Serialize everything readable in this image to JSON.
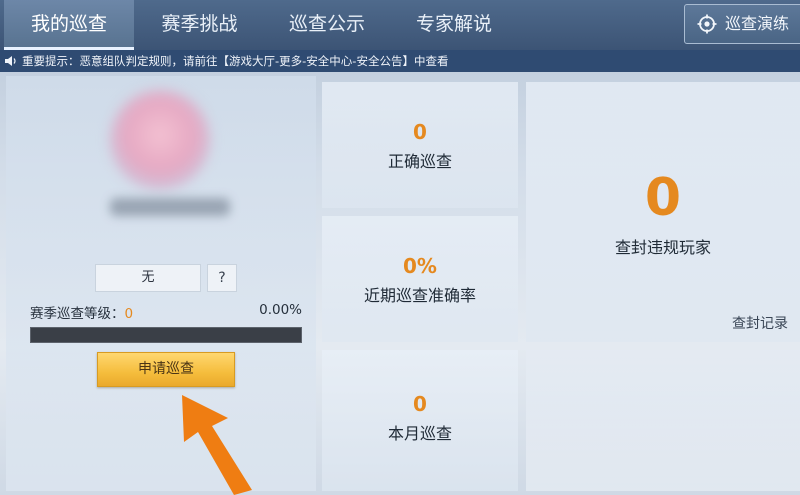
{
  "tabs": [
    {
      "label": "我的巡查",
      "active": true
    },
    {
      "label": "赛季挑战",
      "active": false
    },
    {
      "label": "巡查公示",
      "active": false
    },
    {
      "label": "专家解说",
      "active": false
    }
  ],
  "drill_button": {
    "label": "巡查演练",
    "icon": "crosshair-icon"
  },
  "notice": {
    "icon": "speaker-icon",
    "text": "重要提示：恶意组队判定规则，请前往【游戏大厅-更多-安全中心-安全公告】中查看"
  },
  "profile": {
    "rank": "无",
    "help": "?",
    "level_label": "赛季巡查等级：",
    "level_value": "0",
    "level_percent": "0.00%",
    "progress_fraction": 0,
    "apply_button": "申请巡查"
  },
  "stats": {
    "correct": {
      "value": "0",
      "label": "正确巡查"
    },
    "accuracy": {
      "value": "0%",
      "label": "近期巡查准确率"
    },
    "month": {
      "value": "0",
      "label": "本月巡查"
    },
    "banned": {
      "value": "0",
      "label": "查封违规玩家"
    }
  },
  "records_link": "查封记录",
  "colors": {
    "accent": "#e5891f",
    "topbar": "#4f6a8c",
    "notice": "#2f4b72",
    "button": "#f5bd3c"
  }
}
